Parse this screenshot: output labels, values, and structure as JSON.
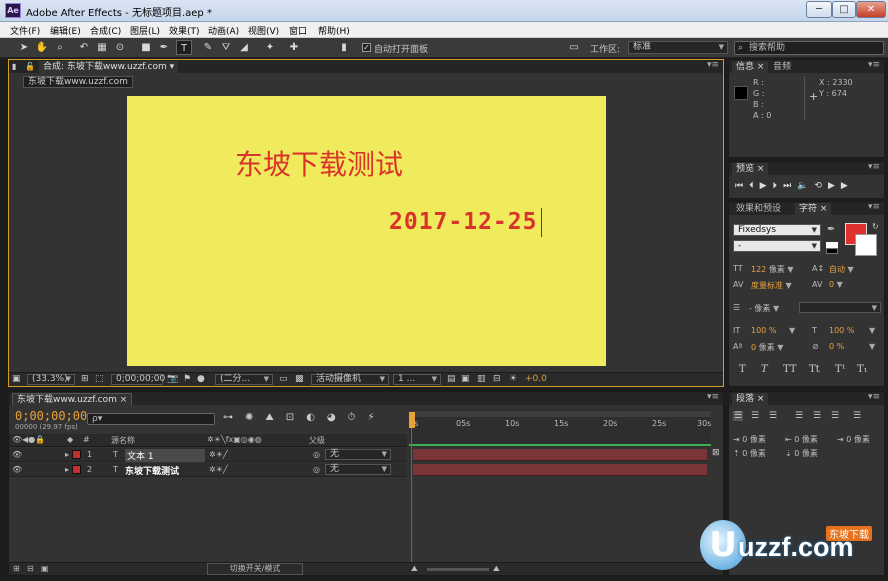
{
  "titlebar": {
    "app_icon": "Ae",
    "title": "Adobe After Effects - 无标题项目.aep *",
    "minimize": "─",
    "maximize": "□",
    "close": "✕"
  },
  "menu": [
    "文件(F)",
    "编辑(E)",
    "合成(C)",
    "图层(L)",
    "效果(T)",
    "动画(A)",
    "视图(V)",
    "窗口",
    "帮助(H)"
  ],
  "toolbar": {
    "auto_open_checkbox_mark": "✓",
    "auto_open_label": "自动打开面板",
    "workspace_label": "工作区:",
    "workspace_value": "标准",
    "search_placeholder": "搜索帮助"
  },
  "composition": {
    "tab_label": "合成: 东坡下载www.uzzf.com",
    "breadcrumb": "东坡下载www.uzzf.com",
    "canvas_color": "#f0eb5c",
    "text_main": "东坡下载测试",
    "text_date": "2017-12-25",
    "text_color": "#d9342b",
    "zoom": "(33.3%)",
    "timecode": "0;00;00;00",
    "resolution": "(二分...",
    "camera": "活动摄像机",
    "view": "1 ...",
    "exposure": "+0.0"
  },
  "info_panel": {
    "tabs": [
      "信息",
      "音频"
    ],
    "r": "R :",
    "g": "G :",
    "b": "B :",
    "a": "A : 0",
    "x": "X : 2330",
    "y": "Y : 674"
  },
  "preview_panel": {
    "tab": "预览"
  },
  "character_panel": {
    "tabs": [
      "效果和预设",
      "字符"
    ],
    "font": "Fixedsys",
    "style": "-",
    "size_value": "122",
    "size_unit": "像素",
    "leading": "自动",
    "kerning": "度量标准",
    "tracking": "0",
    "stroke_unit": "- 像素",
    "v_scale": "100 %",
    "h_scale": "100 %",
    "baseline_value": "0",
    "baseline_unit": "像素",
    "tsume": "0 %",
    "fill_color": "#e03030",
    "styles": [
      "T",
      "T",
      "TT",
      "Tt",
      "T¹",
      "T₁"
    ]
  },
  "paragraph_panel": {
    "tab": "段落",
    "indent_left": "0 像素",
    "indent_right": "0 像素",
    "indent_first": "0 像素",
    "space_before": "0 像素",
    "space_after": "0 像素"
  },
  "timeline": {
    "tab": "东坡下载www.uzzf.com",
    "timecode": "0;00;00;00",
    "frames": "00000 (29.97 fps)",
    "search_placeholder": "ρ▾",
    "col_name": "源名称",
    "col_parent": "父级",
    "ruler": [
      "0s",
      "05s",
      "10s",
      "15s",
      "20s",
      "25s",
      "30s"
    ],
    "layers": [
      {
        "num": "1",
        "name": "文本 1",
        "parent": "无"
      },
      {
        "num": "2",
        "name": "东坡下载测试",
        "parent": "无"
      }
    ],
    "toggle_label": "切换开关/模式"
  },
  "watermark": {
    "logo": "uzzf.com",
    "badge": "东坡下载"
  }
}
